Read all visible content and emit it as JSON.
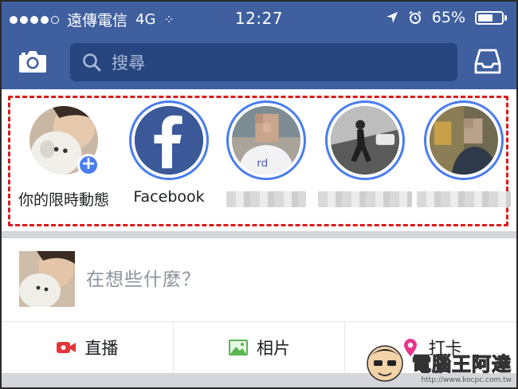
{
  "status_bar": {
    "carrier": "遠傳電信",
    "network": "4G",
    "time": "12:27",
    "battery_percent": "65%",
    "battery_level": 0.65,
    "signal_dots_filled": 4,
    "signal_dots_total": 5
  },
  "nav": {
    "search_placeholder": "搜尋",
    "camera_icon": "camera-icon",
    "inbox_icon": "inbox-icon"
  },
  "stories": {
    "items": [
      {
        "name": "你的限時動態",
        "type": "self",
        "has_add": true
      },
      {
        "name": "Facebook",
        "type": "page"
      },
      {
        "name": "",
        "type": "friend",
        "name_obscured": true
      },
      {
        "name": "",
        "type": "friend",
        "name_obscured": true
      },
      {
        "name": "",
        "type": "friend",
        "name_obscured": true
      }
    ]
  },
  "composer": {
    "prompt": "在想些什麼？"
  },
  "actions": [
    {
      "label": "直播",
      "icon": "live-video-icon",
      "color": "#e4353b"
    },
    {
      "label": "相片",
      "icon": "photo-icon",
      "color": "#5ab552"
    },
    {
      "label": "打卡",
      "icon": "location-pin-icon",
      "color": "#e9348b"
    }
  ],
  "watermark": {
    "title": "電腦王阿達",
    "url": "http://www.kocpc.com.tw"
  },
  "colors": {
    "brand_blue": "#3f5f9f",
    "story_ring": "#4a7df0",
    "highlight_dash": "#dd1a1a"
  }
}
